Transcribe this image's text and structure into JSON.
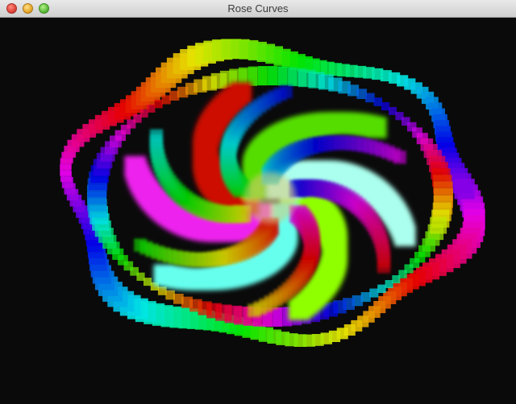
{
  "window": {
    "title": "Rose Curves"
  },
  "titlebar_buttons": [
    {
      "name": "close-button"
    },
    {
      "name": "minimize-button"
    },
    {
      "name": "zoom-button"
    }
  ],
  "visualization": {
    "background": "#0a0a0a",
    "palette": [
      "#ff00ff",
      "#7a00ff",
      "#2a1aff",
      "#8fff00",
      "#55dd00",
      "#dd1100",
      "#aa0000",
      "#66ffee",
      "#ffffff",
      "#cc7700",
      "#ff00aa"
    ],
    "petals": 6
  }
}
